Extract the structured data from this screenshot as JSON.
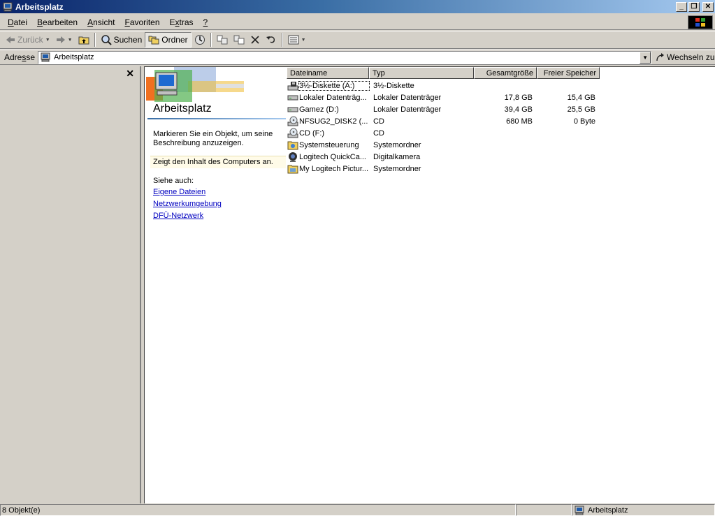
{
  "window": {
    "title": "Arbeitsplatz"
  },
  "menu": {
    "items": [
      {
        "pre": "",
        "key": "D",
        "post": "atei"
      },
      {
        "pre": "",
        "key": "B",
        "post": "earbeiten"
      },
      {
        "pre": "",
        "key": "A",
        "post": "nsicht"
      },
      {
        "pre": "",
        "key": "F",
        "post": "avoriten"
      },
      {
        "pre": "E",
        "key": "x",
        "post": "tras"
      },
      {
        "pre": "",
        "key": "?",
        "post": ""
      }
    ]
  },
  "toolbar": {
    "back_label": "Zurück",
    "search_label": "Suchen",
    "folders_label": "Ordner"
  },
  "address": {
    "label_pre": "Adre",
    "label_key": "s",
    "label_post": "se",
    "value": "Arbeitsplatz",
    "go_label": "Wechseln zu"
  },
  "webview": {
    "title": "Arbeitsplatz",
    "description": "Markieren Sie ein Objekt, um seine Beschreibung anzuzeigen.",
    "info": "Zeigt den Inhalt des Computers an.",
    "see_also": "Siehe auch:",
    "links": [
      "Eigene Dateien",
      "Netzwerkumgebung",
      "DFÜ-Netzwerk"
    ]
  },
  "list": {
    "columns": {
      "name": "Dateiname",
      "type": "Typ",
      "size": "Gesamtgröße",
      "free": "Freier Speicher"
    },
    "rows": [
      {
        "icon": "floppy-drive-icon",
        "name": "3½-Diskette (A:)",
        "type": "3½-Diskette",
        "size": "",
        "free": ""
      },
      {
        "icon": "hard-drive-icon",
        "name": "Lokaler Datenträg...",
        "type": "Lokaler Datenträger",
        "size": "17,8 GB",
        "free": "15,4 GB"
      },
      {
        "icon": "hard-drive-icon",
        "name": "Gamez (D:)",
        "type": "Lokaler Datenträger",
        "size": "39,4 GB",
        "free": "25,5 GB"
      },
      {
        "icon": "cd-drive-icon",
        "name": "NFSUG2_DISK2 (...",
        "type": "CD",
        "size": "680 MB",
        "free": "0 Byte"
      },
      {
        "icon": "cd-drive-icon",
        "name": "CD (F:)",
        "type": "CD",
        "size": "",
        "free": ""
      },
      {
        "icon": "control-panel-icon",
        "name": "Systemsteuerung",
        "type": "Systemordner",
        "size": "",
        "free": ""
      },
      {
        "icon": "camera-icon",
        "name": "Logitech QuickCa...",
        "type": "Digitalkamera",
        "size": "",
        "free": ""
      },
      {
        "icon": "pictures-folder-icon",
        "name": "My Logitech Pictur...",
        "type": "Systemordner",
        "size": "",
        "free": ""
      }
    ]
  },
  "status": {
    "count": "8 Objekt(e)",
    "zone": "Arbeitsplatz"
  },
  "colors": {
    "titlebar_start": "#0a246a",
    "titlebar_end": "#a6caf0",
    "face": "#d4d0c8",
    "link": "#0000c0"
  }
}
